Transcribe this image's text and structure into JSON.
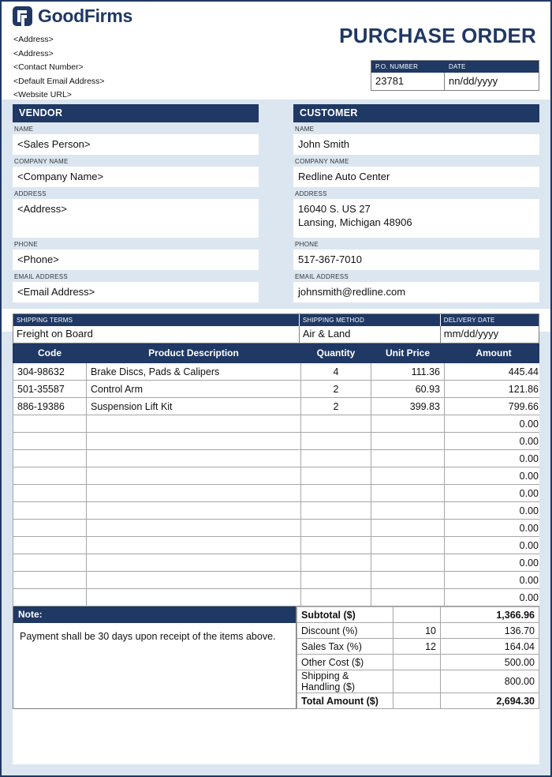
{
  "brand": {
    "logo_text": "GoodFirms",
    "logo_icon": "goodfirms-logo-icon",
    "accent_color": "#1F3864",
    "panel_color": "#DCE6F1"
  },
  "company_lines": [
    "<Address>",
    "<Address>",
    "<Contact Number>",
    "<Default Email Address>",
    "<Website URL>"
  ],
  "document": {
    "title": "PURCHASE ORDER",
    "po_number_label": "P.O. NUMBER",
    "po_number_value": "23781",
    "date_label": "DATE",
    "date_value": "nn/dd/yyyy"
  },
  "vendor": {
    "heading": "VENDOR",
    "name_label": "NAME",
    "name_value": "<Sales Person>",
    "company_label": "COMPANY NAME",
    "company_value": "<Company Name>",
    "address_label": "ADDRESS",
    "address_line1": "<Address>",
    "address_line2": "",
    "phone_label": "PHONE",
    "phone_value": "<Phone>",
    "email_label": "EMAIL ADDRESS",
    "email_value": "<Email Address>"
  },
  "customer": {
    "heading": "CUSTOMER",
    "name_label": "NAME",
    "name_value": "John Smith",
    "company_label": "COMPANY NAME",
    "company_value": "Redline Auto Center",
    "address_label": "ADDRESS",
    "address_line1": "16040 S. US 27",
    "address_line2": "Lansing, Michigan 48906",
    "phone_label": "PHONE",
    "phone_value": "517-367-7010",
    "email_label": "EMAIL ADDRESS",
    "email_value": "johnsmith@redline.com"
  },
  "shipping": {
    "terms_label": "SHIPPING TERMS",
    "terms_value": "Freight on Board",
    "method_label": "SHIPPING METHOD",
    "method_value": "Air & Land",
    "delivery_label": "DELIVERY DATE",
    "delivery_value": "mm/dd/yyyy"
  },
  "items_table": {
    "columns": [
      "Code",
      "Product Description",
      "Quantity",
      "Unit Price",
      "Amount"
    ],
    "rows": [
      {
        "code": "304-98632",
        "description": "Brake Discs, Pads & Calipers",
        "quantity": "4",
        "unit_price": "111.36",
        "amount": "445.44"
      },
      {
        "code": "501-35587",
        "description": "Control Arm",
        "quantity": "2",
        "unit_price": "60.93",
        "amount": "121.86"
      },
      {
        "code": "886-19386",
        "description": "Suspension Lift Kit",
        "quantity": "2",
        "unit_price": "399.83",
        "amount": "799.66"
      },
      {
        "code": "",
        "description": "",
        "quantity": "",
        "unit_price": "",
        "amount": "0.00"
      },
      {
        "code": "",
        "description": "",
        "quantity": "",
        "unit_price": "",
        "amount": "0.00"
      },
      {
        "code": "",
        "description": "",
        "quantity": "",
        "unit_price": "",
        "amount": "0.00"
      },
      {
        "code": "",
        "description": "",
        "quantity": "",
        "unit_price": "",
        "amount": "0.00"
      },
      {
        "code": "",
        "description": "",
        "quantity": "",
        "unit_price": "",
        "amount": "0.00"
      },
      {
        "code": "",
        "description": "",
        "quantity": "",
        "unit_price": "",
        "amount": "0.00"
      },
      {
        "code": "",
        "description": "",
        "quantity": "",
        "unit_price": "",
        "amount": "0.00"
      },
      {
        "code": "",
        "description": "",
        "quantity": "",
        "unit_price": "",
        "amount": "0.00"
      },
      {
        "code": "",
        "description": "",
        "quantity": "",
        "unit_price": "",
        "amount": "0.00"
      },
      {
        "code": "",
        "description": "",
        "quantity": "",
        "unit_price": "",
        "amount": "0.00"
      },
      {
        "code": "",
        "description": "",
        "quantity": "",
        "unit_price": "",
        "amount": "0.00"
      }
    ]
  },
  "note": {
    "heading": "Note:",
    "text": "Payment shall be 30 days upon receipt of the items above."
  },
  "totals": {
    "rows": [
      {
        "label": "Subtotal ($)",
        "rate": "",
        "value": "1,366.96",
        "bold": true
      },
      {
        "label": "Discount (%)",
        "rate": "10",
        "value": "136.70",
        "bold": false
      },
      {
        "label": "Sales Tax (%)",
        "rate": "12",
        "value": "164.04",
        "bold": false
      },
      {
        "label": "Other Cost ($)",
        "rate": "",
        "value": "500.00",
        "bold": false
      },
      {
        "label": "Shipping & Handling ($)",
        "rate": "",
        "value": "800.00",
        "bold": false
      },
      {
        "label": "Total Amount ($)",
        "rate": "",
        "value": "2,694.30",
        "bold": true
      }
    ]
  }
}
